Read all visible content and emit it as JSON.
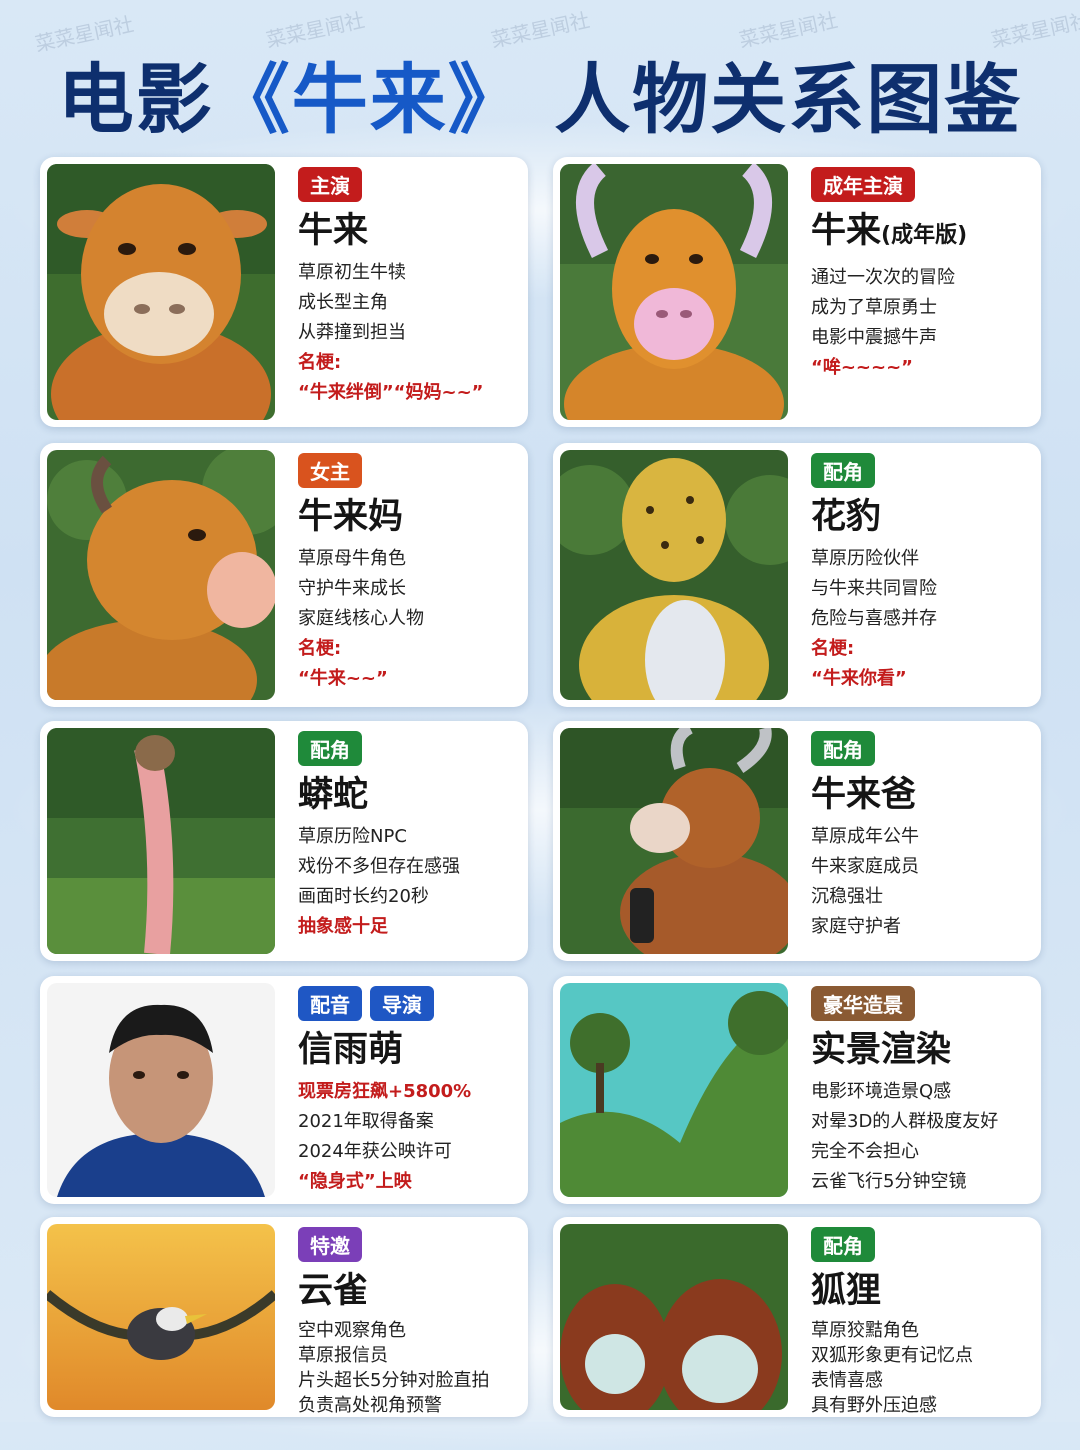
{
  "page": {
    "title_prefix": "电影",
    "title_film": "《牛来》",
    "title_suffix": "人物关系图鉴",
    "watermark": "菜菜星闻社",
    "colors": {
      "title": "#0e2f6e",
      "accent": "#1659c7",
      "red": "#c31c1c",
      "green": "#1f8a3a",
      "blue": "#1f57c4",
      "purple": "#7b3fb8",
      "brown": "#8a5a33",
      "orange": "#d9531e"
    }
  },
  "cards": [
    {
      "tags": [
        {
          "label": "主演",
          "color": "#c31c1c"
        }
      ],
      "name": "牛来",
      "name_sub": "",
      "lines": [
        "草原初生牛犊",
        "成长型主角",
        "从莽撞到担当"
      ],
      "meme_label": "名梗:",
      "meme": "“牛来绊倒”“妈妈~~”",
      "highlight": "",
      "after": [],
      "photo_icon": "calf-face-icon"
    },
    {
      "tags": [
        {
          "label": "成年主演",
          "color": "#c31c1c"
        }
      ],
      "name": "牛来",
      "name_sub": "(成年版)",
      "lines": [
        "通过一次次的冒险",
        "成为了草原勇士",
        "电影中震撼牛声"
      ],
      "meme_label": "",
      "meme": "“哞~~~~”",
      "highlight": "",
      "after": [],
      "photo_icon": "adult-bull-face-icon"
    },
    {
      "tags": [
        {
          "label": "女主",
          "color": "#d9531e"
        }
      ],
      "name": "牛来妈",
      "name_sub": "",
      "lines": [
        "草原母牛角色",
        "守护牛来成长",
        "家庭线核心人物"
      ],
      "meme_label": "名梗:",
      "meme": "“牛来~~”",
      "highlight": "",
      "after": [],
      "photo_icon": "mother-cow-icon"
    },
    {
      "tags": [
        {
          "label": "配角",
          "color": "#1f8a3a"
        }
      ],
      "name": "花豹",
      "name_sub": "",
      "lines": [
        "草原历险伙伴",
        "与牛来共同冒险",
        "危险与喜感并存"
      ],
      "meme_label": "名梗:",
      "meme": "“牛来你看”",
      "highlight": "",
      "after": [],
      "photo_icon": "leopard-icon"
    },
    {
      "tags": [
        {
          "label": "配角",
          "color": "#1f8a3a"
        }
      ],
      "name": "蟒蛇",
      "name_sub": "",
      "lines": [
        "草原历险NPC",
        "戏份不多但存在感强",
        "画面时长约20秒"
      ],
      "meme_label": "",
      "meme": "抽象感十足",
      "highlight": "",
      "after": [],
      "photo_icon": "python-snake-icon"
    },
    {
      "tags": [
        {
          "label": "配角",
          "color": "#1f8a3a"
        }
      ],
      "name": "牛来爸",
      "name_sub": "",
      "lines": [
        "草原成年公牛",
        "牛来家庭成员",
        "沉稳强壮",
        "家庭守护者"
      ],
      "meme_label": "",
      "meme": "",
      "highlight": "",
      "after": [],
      "photo_icon": "father-bull-icon"
    },
    {
      "tags": [
        {
          "label": "配音",
          "color": "#1f57c4"
        },
        {
          "label": "导演",
          "color": "#1f57c4"
        }
      ],
      "name": "信雨萌",
      "name_sub": "",
      "lines": [],
      "meme_label": "",
      "meme": "",
      "highlight": "现票房狂飙+5800%",
      "after": [
        "2021年取得备案",
        "2024年获公映许可"
      ],
      "after_red": "“隐身式”上映",
      "photo_icon": "director-portrait-icon"
    },
    {
      "tags": [
        {
          "label": "豪华造景",
          "color": "#8a5a33"
        }
      ],
      "name": "实景渲染",
      "name_sub": "",
      "lines": [
        "电影环境造景Q感",
        "对晕3D的人群极度友好",
        "完全不会担心",
        "云雀飞行5分钟空镜"
      ],
      "meme_label": "",
      "meme": "",
      "highlight": "",
      "after": [],
      "photo_icon": "landscape-icon"
    },
    {
      "tags": [
        {
          "label": "特邀",
          "color": "#7b3fb8"
        }
      ],
      "name": "云雀",
      "name_sub": "",
      "lines": [
        "空中观察角色",
        "草原报信员",
        "片头超长5分钟对脸直拍",
        "负责高处视角预警"
      ],
      "meme_label": "",
      "meme": "",
      "highlight": "",
      "after": [],
      "photo_icon": "lark-bird-icon"
    },
    {
      "tags": [
        {
          "label": "配角",
          "color": "#1f8a3a"
        }
      ],
      "name": "狐狸",
      "name_sub": "",
      "lines": [
        "草原狡黠角色",
        "双狐形象更有记忆点",
        "表情喜感",
        "具有野外压迫感"
      ],
      "meme_label": "",
      "meme": "",
      "highlight": "",
      "after": [],
      "photo_icon": "two-foxes-icon"
    }
  ]
}
